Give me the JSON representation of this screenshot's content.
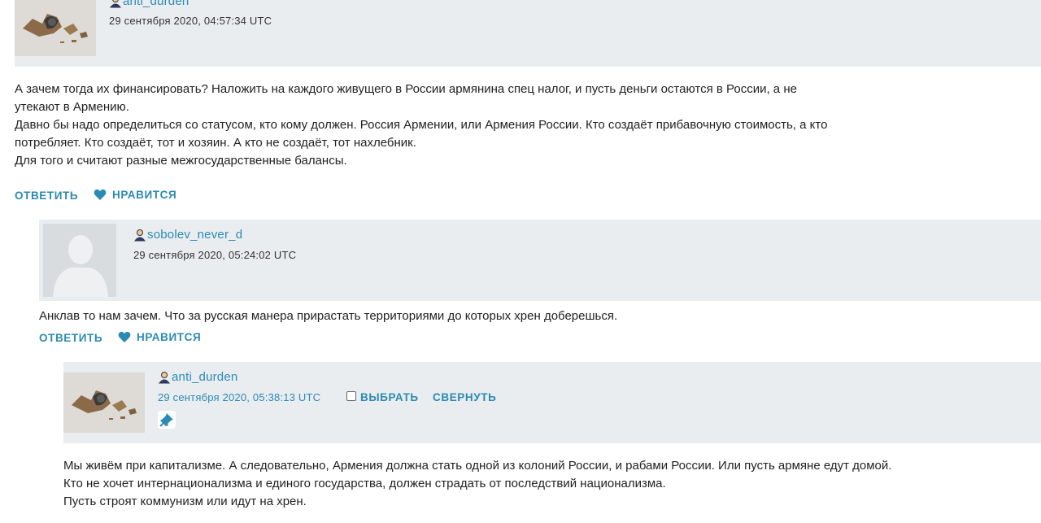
{
  "comments": [
    {
      "username": "anti_durden",
      "timestamp": "29 сентября 2020, 04:57:34 UTC",
      "avatar_icon": "photo-avatar-icon",
      "body": [
        "А зачем тогда их финансировать? Наложить на каждого живущего в России армянина спец налог, и пусть деньги остаются в России, а не",
        "утекают в Армению.",
        "Давно бы надо определиться со статусом, кто кому должен. Россия Армении, или Армения России. Кто создаёт прибавочную стоимость, а кто",
        "потребляет. Кто создаёт, тот и хозяин. А кто не создаёт, тот нахлебник.",
        "Для того и считают разные межгосударственные балансы."
      ],
      "reply_label": "ОТВЕТИТЬ",
      "like_label": "НРАВИТСЯ"
    },
    {
      "username": "sobolev_never_d",
      "timestamp": "29 сентября 2020, 05:24:02 UTC",
      "avatar_icon": "default-avatar-icon",
      "body": [
        "Анклав то нам зачем. Что за русская манера прирастать территориями до которых хрен доберешься."
      ],
      "reply_label": "ОТВЕТИТЬ",
      "like_label": "НРАВИТСЯ"
    },
    {
      "username": "anti_durden",
      "timestamp": "29 сентября 2020, 05:38:13 UTC",
      "avatar_icon": "photo-avatar-icon",
      "select_label": "ВЫБРАТЬ",
      "collapse_label": "СВЕРНУТЬ",
      "pin_icon": "pin-icon",
      "body": [
        "Мы живём при капитализме. А следовательно, Армения должна стать одной из колоний России, и рабами России. Или пусть армяне едут домой.",
        "Кто не хочет интернационализма и единого государства, должен страдать от последствий национализма.",
        "Пусть строят коммунизм или идут на хрен."
      ]
    }
  ],
  "colors": {
    "link": "#2b8ab3",
    "header_bg": "#e9edf0",
    "text": "#222222"
  }
}
